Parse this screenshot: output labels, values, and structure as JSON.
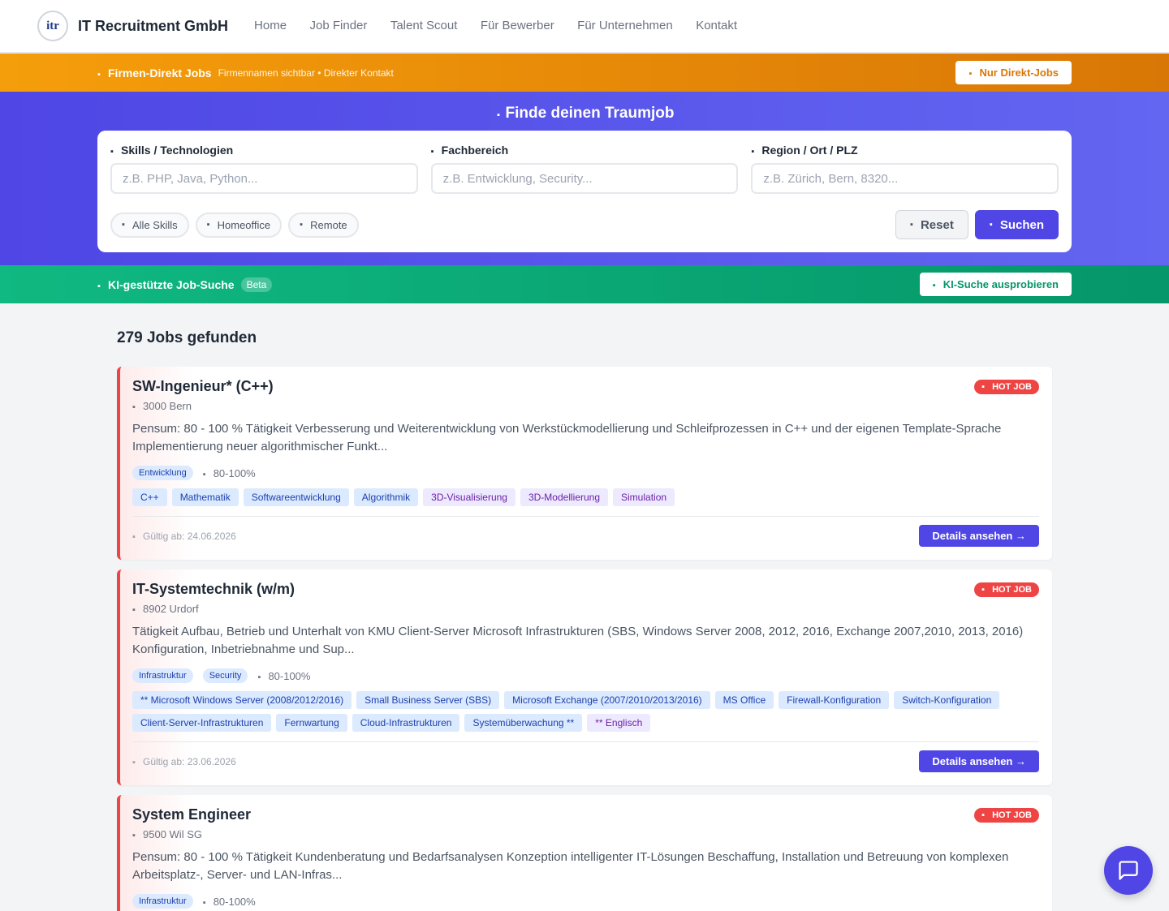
{
  "header": {
    "brand": "IT Recruitment GmbH",
    "logo_text": "itr",
    "nav": [
      "Home",
      "Job Finder",
      "Talent Scout",
      "Für Bewerber",
      "Für Unternehmen",
      "Kontakt"
    ]
  },
  "direkt": {
    "title": "Firmen-Direkt Jobs",
    "subtitle": "Firmennamen sichtbar • Direkter Kontakt",
    "button": "Nur Direkt-Jobs"
  },
  "search": {
    "title": "Finde deinen Traumjob",
    "fields": [
      {
        "label": "Skills / Technologien",
        "placeholder": "z.B. PHP, Java, Python..."
      },
      {
        "label": "Fachbereich",
        "placeholder": "z.B. Entwicklung, Security..."
      },
      {
        "label": "Region / Ort / PLZ",
        "placeholder": "z.B. Zürich, Bern, 8320..."
      }
    ],
    "chips": [
      "Alle Skills",
      "Homeoffice",
      "Remote"
    ],
    "reset": "Reset",
    "submit": "Suchen"
  },
  "ai": {
    "title": "KI-gestützte Job-Suche",
    "badge": "Beta",
    "button": "KI-Suche ausprobieren"
  },
  "results": {
    "count": "279 Jobs gefunden"
  },
  "jobs": [
    {
      "title": "SW-Ingenieur* (C++)",
      "badge": "HOT JOB",
      "location": "3000 Bern",
      "description": "Pensum: 80 - 100 % Tätigkeit Verbesserung und Weiterentwicklung von Werkstückmodellierung und Schleifprozessen in C++ und der eigenen Template-Sprache Implementierung neuer algorithmischer Funkt...",
      "categories": [
        "Entwicklung"
      ],
      "pensum": "80-100%",
      "tags": [
        "C++",
        "Mathematik",
        "Softwareentwicklung",
        "Algorithmik",
        "3D-Visualisierung",
        "3D-Modellierung",
        "Simulation"
      ],
      "valid": "Gültig ab: 24.06.2026",
      "details": "Details ansehen →"
    },
    {
      "title": "IT-Systemtechnik (w/m)",
      "badge": "HOT JOB",
      "location": "8902 Urdorf",
      "description": "Tätigkeit Aufbau, Betrieb und Unterhalt von KMU Client-Server Microsoft Infrastrukturen (SBS, Windows Server 2008, 2012, 2016, Exchange 2007,2010, 2013, 2016) Konfiguration, Inbetriebnahme und Sup...",
      "categories": [
        "Infrastruktur",
        "Security"
      ],
      "pensum": "80-100%",
      "tags": [
        "** Microsoft Windows Server (2008/2012/2016)",
        "Small Business Server (SBS)",
        "Microsoft Exchange (2007/2010/2013/2016)",
        "MS Office",
        "Firewall-Konfiguration",
        "Switch-Konfiguration",
        "Client-Server-Infrastrukturen",
        "Fernwartung",
        "Cloud-Infrastrukturen",
        "Systemüberwachung **",
        "** Englisch"
      ],
      "valid": "Gültig ab: 23.06.2026",
      "details": "Details ansehen →"
    },
    {
      "title": "System Engineer",
      "badge": "HOT JOB",
      "location": "9500 Wil SG",
      "description": "Pensum: 80 - 100 % Tätigkeit Kundenberatung und Bedarfsanalysen Konzeption intelligenter IT-Lösungen Beschaffung, Installation und Betreuung von komplexen Arbeitsplatz-, Server- und LAN-Infras...",
      "categories": [
        "Infrastruktur"
      ],
      "pensum": "80-100%",
      "tags": [],
      "valid": "",
      "details": ""
    }
  ],
  "colors": {
    "primary": "#4f46e5",
    "orange": "#f59e0b",
    "green": "#10b981",
    "hot": "#ef4444"
  }
}
